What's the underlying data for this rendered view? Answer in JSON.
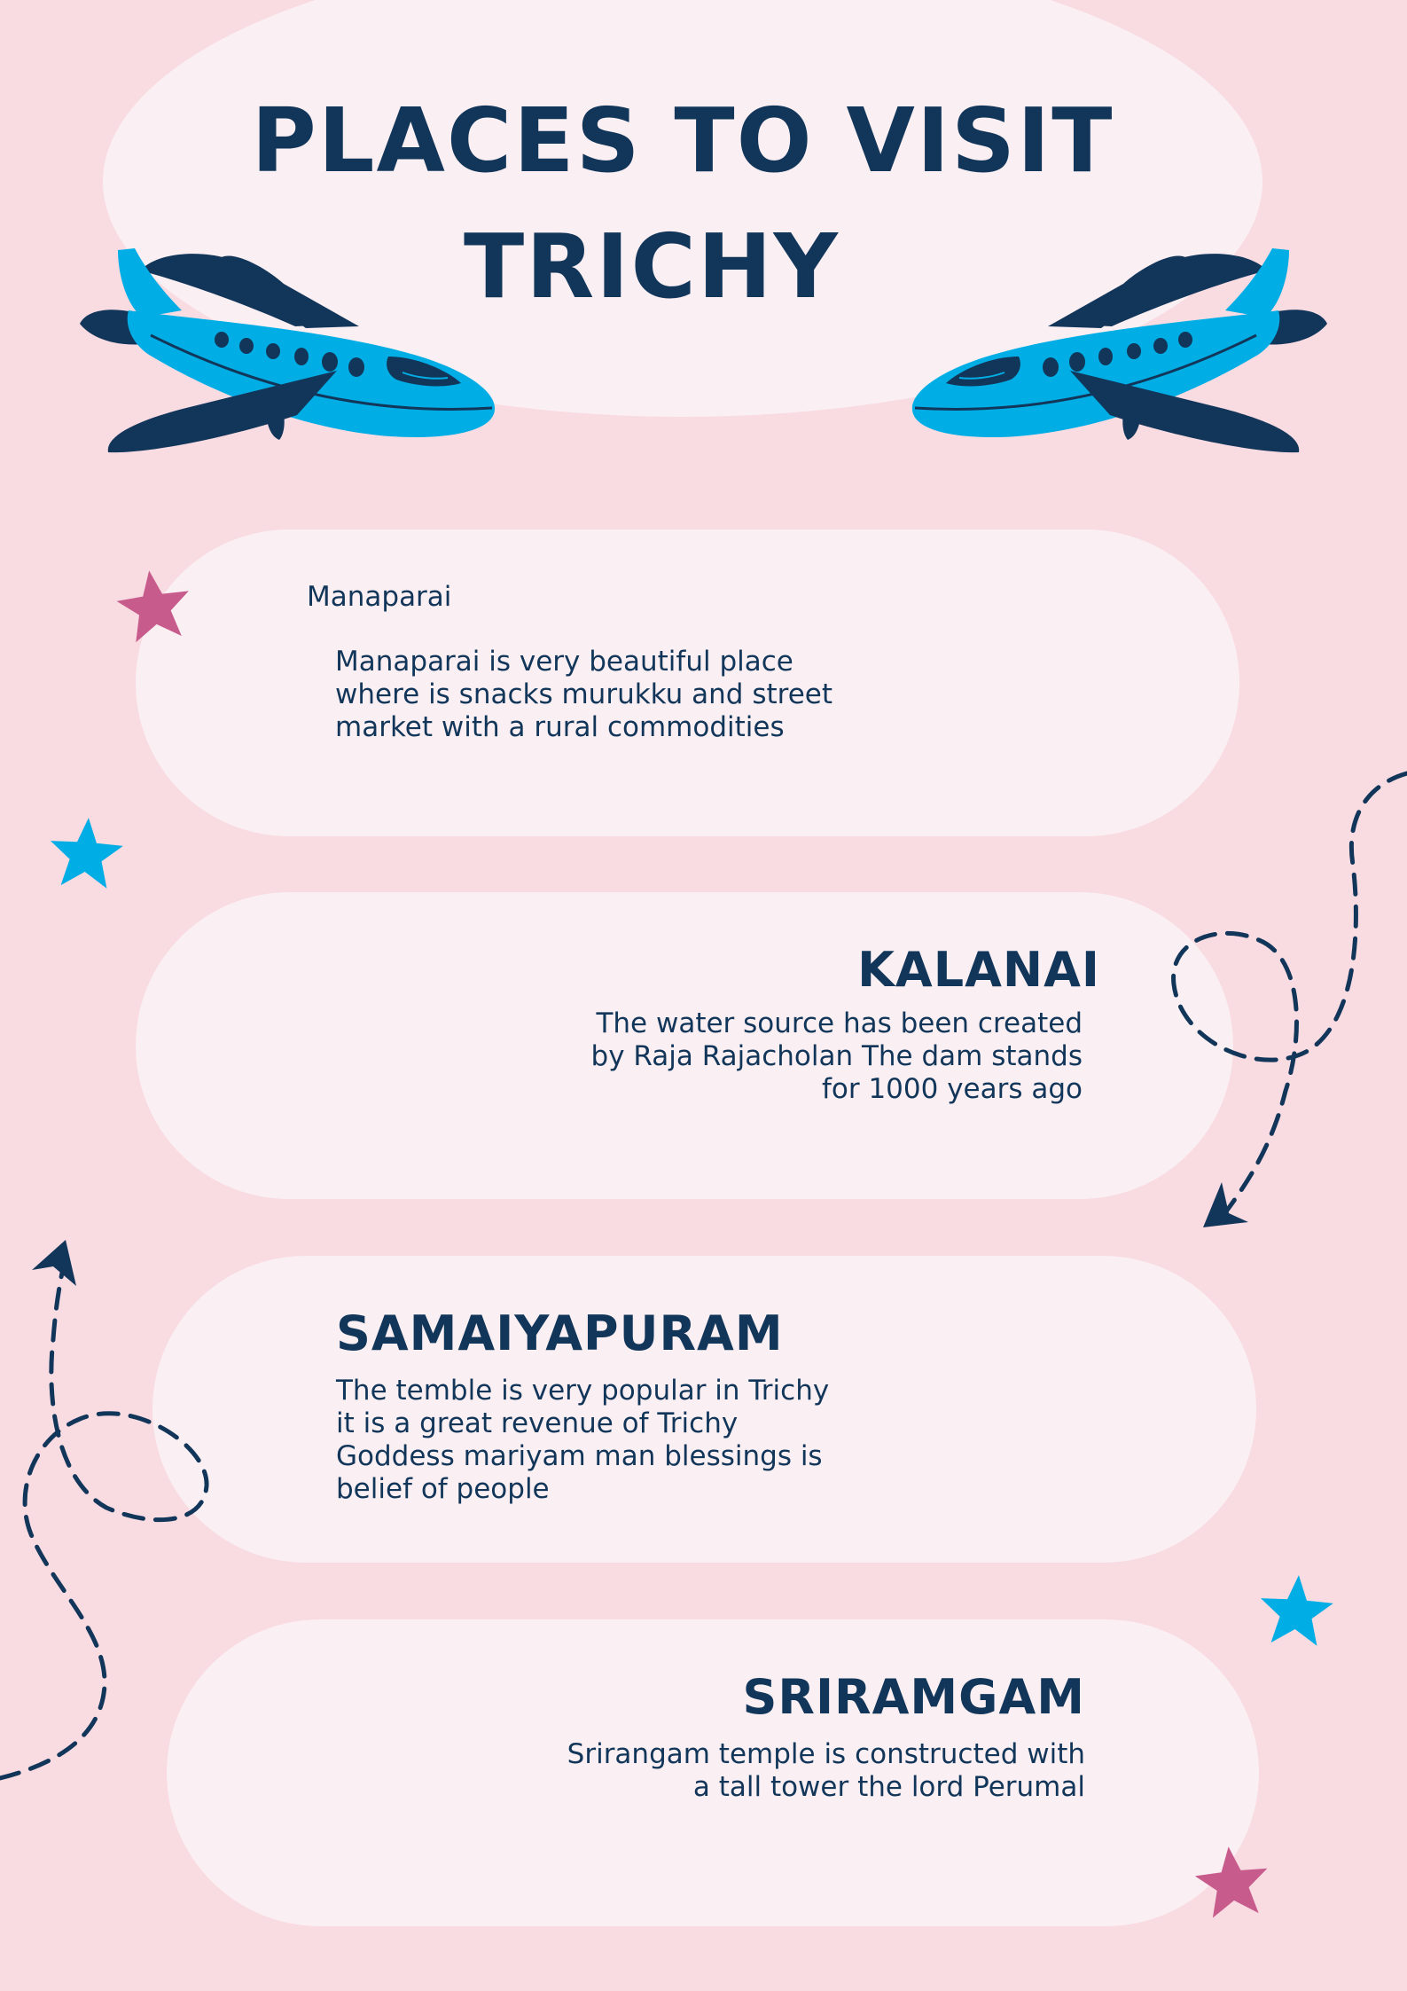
{
  "title": {
    "line1": "PLACES TO VISIT",
    "line2": "TRICHY"
  },
  "places": [
    {
      "name": "Manaparai",
      "description": "Manaparai is very beautiful place where is snacks murukku and street market with a rural commodities"
    },
    {
      "name": "KALANAI",
      "description": "The water source has been created by Raja Rajacholan The dam stands for 1000 years ago"
    },
    {
      "name": "SAMAIYAPURAM",
      "description": "The temble is very popular in Trichy it is a great revenue of Trichy Goddess mariyam man blessings is belief of people"
    },
    {
      "name": "SRIRAMGAM",
      "description": "Srirangam temple is constructed with a tall tower the lord  Perumal"
    }
  ],
  "icons": {
    "airplane": "airplane-icon",
    "star": "star-icon",
    "dashed_path": "dashed-flight-path"
  },
  "colors": {
    "background": "#f9dbe2",
    "card": "#faeff2",
    "navy": "#12365a",
    "sky_blue": "#00aee5",
    "magenta": "#c75b8c"
  }
}
